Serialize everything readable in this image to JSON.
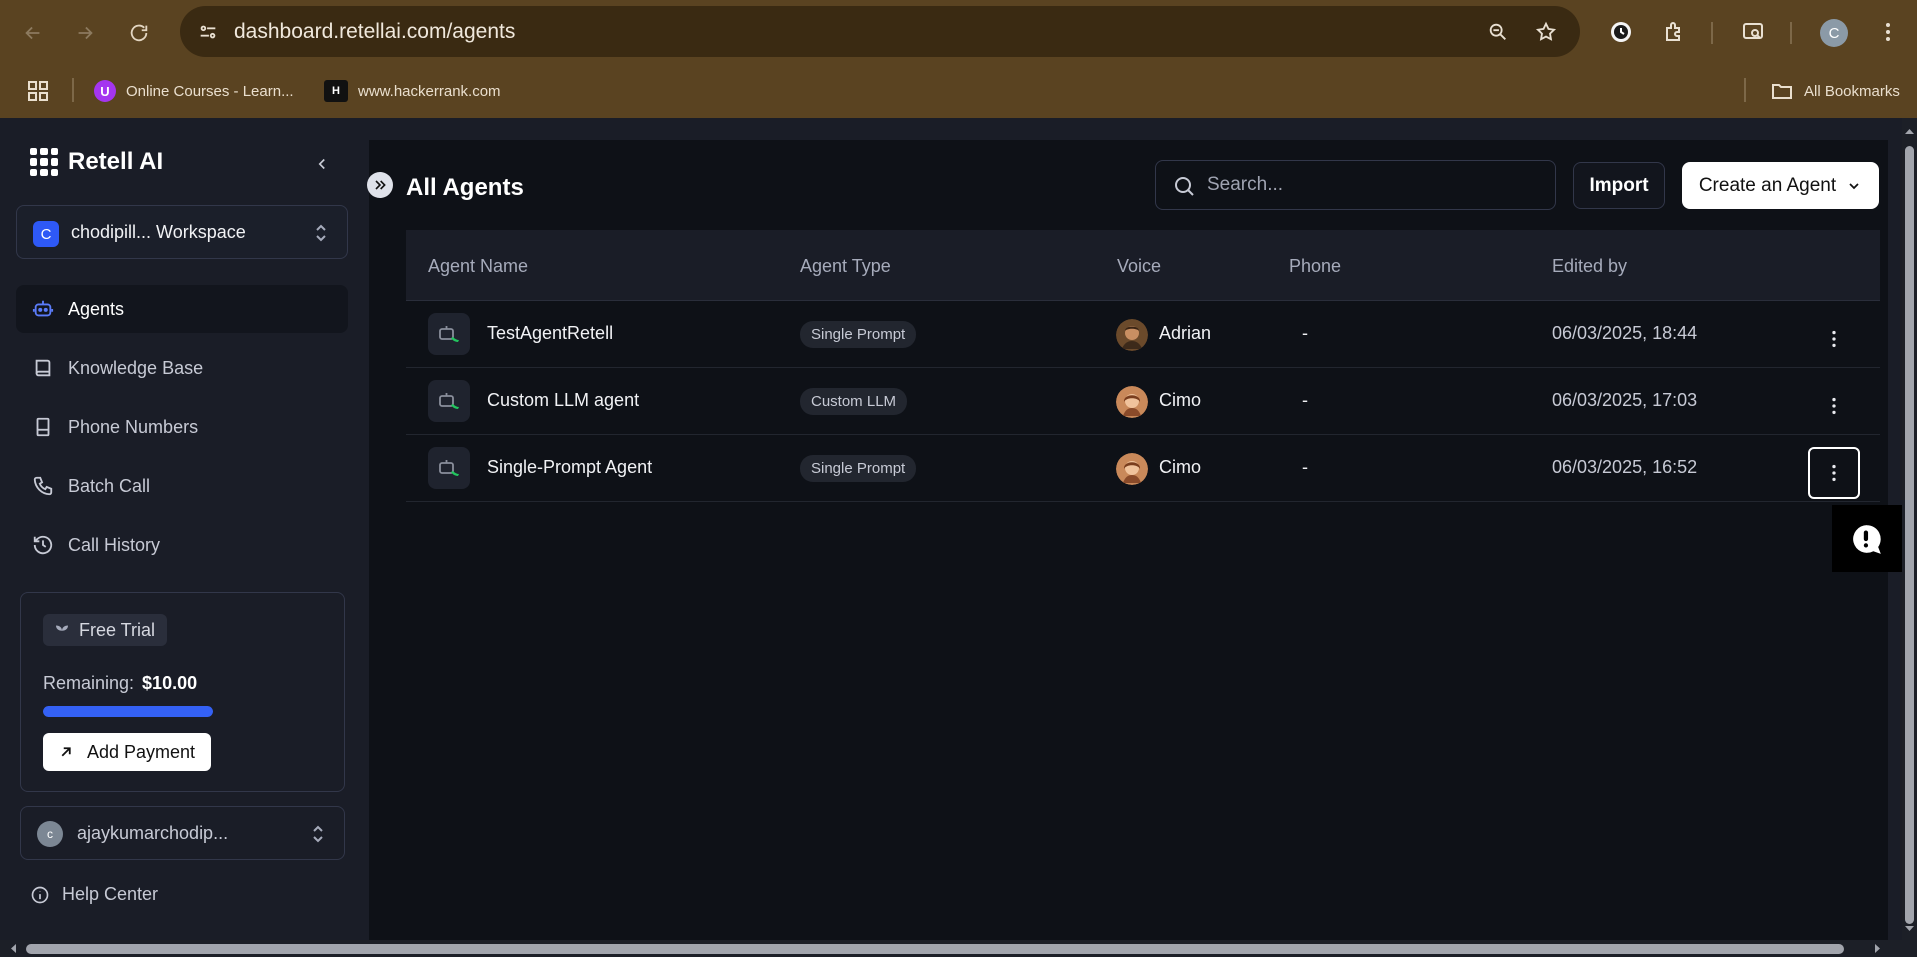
{
  "browser": {
    "url": "dashboard.retellai.com/agents",
    "bookmarks": [
      {
        "label": "Online Courses - Learn...",
        "icon": "udemy-icon"
      },
      {
        "label": "www.hackerrank.com",
        "icon": "hackerrank-icon"
      }
    ],
    "all_bookmarks": "All Bookmarks",
    "profile_initial": "C"
  },
  "sidebar": {
    "brand": "Retell AI",
    "workspace": {
      "initial": "C",
      "name": "chodipill... Workspace"
    },
    "menu": [
      {
        "label": "Agents",
        "icon": "robot-icon",
        "active": true
      },
      {
        "label": "Knowledge Base",
        "icon": "book-icon"
      },
      {
        "label": "Phone Numbers",
        "icon": "phone-device-icon"
      },
      {
        "label": "Batch Call",
        "icon": "phone-icon"
      },
      {
        "label": "Call History",
        "icon": "history-icon"
      }
    ],
    "trial": {
      "badge": "Free Trial",
      "remaining_label": "Remaining:",
      "remaining_value": "$10.00",
      "progress": 1.0,
      "add_payment": "Add Payment"
    },
    "user": {
      "initial": "c",
      "name": "ajaykumarchodip..."
    },
    "help": "Help Center"
  },
  "main": {
    "title": "All Agents",
    "search_placeholder": "Search...",
    "import_label": "Import",
    "create_label": "Create an Agent",
    "columns": [
      "Agent Name",
      "Agent Type",
      "Voice",
      "Phone",
      "Edited by"
    ],
    "rows": [
      {
        "name": "TestAgentRetell",
        "type": "Single Prompt",
        "voice": "Adrian",
        "phone": "-",
        "edited": "06/03/2025, 18:44"
      },
      {
        "name": "Custom LLM agent",
        "type": "Custom LLM",
        "voice": "Cimo",
        "phone": "-",
        "edited": "06/03/2025, 17:03"
      },
      {
        "name": "Single-Prompt Agent",
        "type": "Single Prompt",
        "voice": "Cimo",
        "phone": "-",
        "edited": "06/03/2025, 16:52"
      }
    ]
  },
  "colors": {
    "accent": "#3461f5",
    "workspace_badge": "#2e59f6",
    "agent_icon_green": "#22c55e"
  }
}
